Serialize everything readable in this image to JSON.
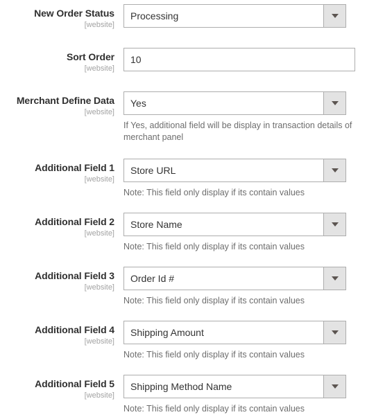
{
  "scope_label": "[website]",
  "caret_icon": "chevron-down-icon",
  "rows": [
    {
      "label": "New Order Status",
      "scope": "[website]",
      "control": "select",
      "value": "Processing",
      "note": ""
    },
    {
      "label": "Sort Order",
      "scope": "[website]",
      "control": "text",
      "value": "10",
      "placeholder": "",
      "note": ""
    },
    {
      "label": "Merchant Define Data",
      "scope": "[website]",
      "control": "select",
      "value": "Yes",
      "note": "If Yes, additional field will be display in transaction details of merchant panel"
    },
    {
      "label": "Additional Field 1",
      "scope": "[website]",
      "control": "select",
      "value": "Store URL",
      "note": "Note: This field only display if its contain values"
    },
    {
      "label": "Additional Field 2",
      "scope": "[website]",
      "control": "select",
      "value": "Store Name",
      "note": "Note: This field only display if its contain values"
    },
    {
      "label": "Additional Field 3",
      "scope": "[website]",
      "control": "select",
      "value": "Order Id #",
      "note": "Note: This field only display if its contain values"
    },
    {
      "label": "Additional Field 4",
      "scope": "[website]",
      "control": "select",
      "value": "Shipping Amount",
      "note": "Note: This field only display if its contain values"
    },
    {
      "label": "Additional Field 5",
      "scope": "[website]",
      "control": "select",
      "value": "Shipping Method Name",
      "note": "Note: This field only display if its contain values"
    }
  ],
  "colors": {
    "label": "#303030",
    "scope": "#a3a3a3",
    "value_text": "#333333",
    "note_text": "#6d6d6d",
    "border": "#adadad",
    "button_bg": "#e3e3e3",
    "caret": "#5c5551"
  }
}
